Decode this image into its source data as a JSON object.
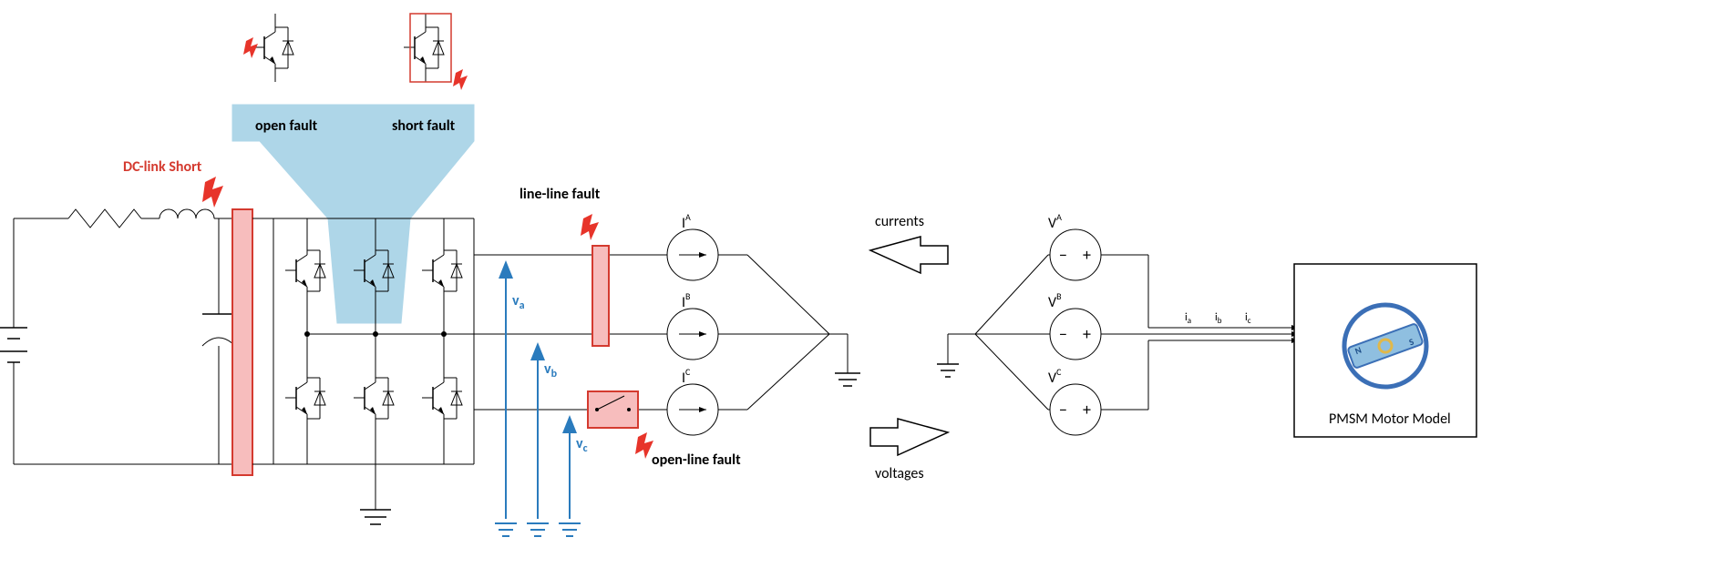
{
  "labels": {
    "dc_link_short": "DC-link Short",
    "open_fault": "open fault",
    "short_fault": "short fault",
    "line_line_fault": "line-line fault",
    "open_line_fault": "open-line fault",
    "currents": "currents",
    "voltages": "voltages",
    "pmsm": "PMSM Motor Model"
  },
  "voltages": {
    "va": "v",
    "va_sub": "a",
    "vb": "v",
    "vb_sub": "b",
    "vc": "v",
    "vc_sub": "c"
  },
  "current_src": {
    "IA": "I",
    "IA_sup": "A",
    "IB": "I",
    "IB_sup": "B",
    "IC": "I",
    "IC_sup": "C"
  },
  "volt_src": {
    "VA": "V",
    "VA_sup": "A",
    "VB": "V",
    "VB_sup": "B",
    "VC": "V",
    "VC_sup": "C"
  },
  "motor_currents": {
    "ia": "i",
    "ia_sub": "a",
    "ib": "i",
    "ib_sub": "b",
    "ic": "i",
    "ic_sub": "c"
  },
  "rotor": {
    "N": "N",
    "S": "S"
  }
}
